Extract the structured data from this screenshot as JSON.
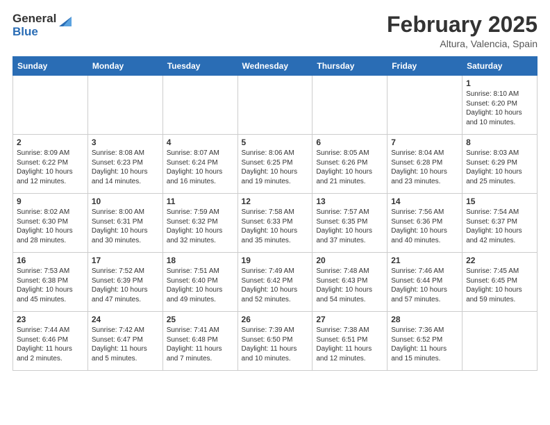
{
  "header": {
    "logo_general": "General",
    "logo_blue": "Blue",
    "month_title": "February 2025",
    "location": "Altura, Valencia, Spain"
  },
  "weekdays": [
    "Sunday",
    "Monday",
    "Tuesday",
    "Wednesday",
    "Thursday",
    "Friday",
    "Saturday"
  ],
  "weeks": [
    [
      {
        "day": "",
        "info": ""
      },
      {
        "day": "",
        "info": ""
      },
      {
        "day": "",
        "info": ""
      },
      {
        "day": "",
        "info": ""
      },
      {
        "day": "",
        "info": ""
      },
      {
        "day": "",
        "info": ""
      },
      {
        "day": "1",
        "info": "Sunrise: 8:10 AM\nSunset: 6:20 PM\nDaylight: 10 hours\nand 10 minutes."
      }
    ],
    [
      {
        "day": "2",
        "info": "Sunrise: 8:09 AM\nSunset: 6:22 PM\nDaylight: 10 hours\nand 12 minutes."
      },
      {
        "day": "3",
        "info": "Sunrise: 8:08 AM\nSunset: 6:23 PM\nDaylight: 10 hours\nand 14 minutes."
      },
      {
        "day": "4",
        "info": "Sunrise: 8:07 AM\nSunset: 6:24 PM\nDaylight: 10 hours\nand 16 minutes."
      },
      {
        "day": "5",
        "info": "Sunrise: 8:06 AM\nSunset: 6:25 PM\nDaylight: 10 hours\nand 19 minutes."
      },
      {
        "day": "6",
        "info": "Sunrise: 8:05 AM\nSunset: 6:26 PM\nDaylight: 10 hours\nand 21 minutes."
      },
      {
        "day": "7",
        "info": "Sunrise: 8:04 AM\nSunset: 6:28 PM\nDaylight: 10 hours\nand 23 minutes."
      },
      {
        "day": "8",
        "info": "Sunrise: 8:03 AM\nSunset: 6:29 PM\nDaylight: 10 hours\nand 25 minutes."
      }
    ],
    [
      {
        "day": "9",
        "info": "Sunrise: 8:02 AM\nSunset: 6:30 PM\nDaylight: 10 hours\nand 28 minutes."
      },
      {
        "day": "10",
        "info": "Sunrise: 8:00 AM\nSunset: 6:31 PM\nDaylight: 10 hours\nand 30 minutes."
      },
      {
        "day": "11",
        "info": "Sunrise: 7:59 AM\nSunset: 6:32 PM\nDaylight: 10 hours\nand 32 minutes."
      },
      {
        "day": "12",
        "info": "Sunrise: 7:58 AM\nSunset: 6:33 PM\nDaylight: 10 hours\nand 35 minutes."
      },
      {
        "day": "13",
        "info": "Sunrise: 7:57 AM\nSunset: 6:35 PM\nDaylight: 10 hours\nand 37 minutes."
      },
      {
        "day": "14",
        "info": "Sunrise: 7:56 AM\nSunset: 6:36 PM\nDaylight: 10 hours\nand 40 minutes."
      },
      {
        "day": "15",
        "info": "Sunrise: 7:54 AM\nSunset: 6:37 PM\nDaylight: 10 hours\nand 42 minutes."
      }
    ],
    [
      {
        "day": "16",
        "info": "Sunrise: 7:53 AM\nSunset: 6:38 PM\nDaylight: 10 hours\nand 45 minutes."
      },
      {
        "day": "17",
        "info": "Sunrise: 7:52 AM\nSunset: 6:39 PM\nDaylight: 10 hours\nand 47 minutes."
      },
      {
        "day": "18",
        "info": "Sunrise: 7:51 AM\nSunset: 6:40 PM\nDaylight: 10 hours\nand 49 minutes."
      },
      {
        "day": "19",
        "info": "Sunrise: 7:49 AM\nSunset: 6:42 PM\nDaylight: 10 hours\nand 52 minutes."
      },
      {
        "day": "20",
        "info": "Sunrise: 7:48 AM\nSunset: 6:43 PM\nDaylight: 10 hours\nand 54 minutes."
      },
      {
        "day": "21",
        "info": "Sunrise: 7:46 AM\nSunset: 6:44 PM\nDaylight: 10 hours\nand 57 minutes."
      },
      {
        "day": "22",
        "info": "Sunrise: 7:45 AM\nSunset: 6:45 PM\nDaylight: 10 hours\nand 59 minutes."
      }
    ],
    [
      {
        "day": "23",
        "info": "Sunrise: 7:44 AM\nSunset: 6:46 PM\nDaylight: 11 hours\nand 2 minutes."
      },
      {
        "day": "24",
        "info": "Sunrise: 7:42 AM\nSunset: 6:47 PM\nDaylight: 11 hours\nand 5 minutes."
      },
      {
        "day": "25",
        "info": "Sunrise: 7:41 AM\nSunset: 6:48 PM\nDaylight: 11 hours\nand 7 minutes."
      },
      {
        "day": "26",
        "info": "Sunrise: 7:39 AM\nSunset: 6:50 PM\nDaylight: 11 hours\nand 10 minutes."
      },
      {
        "day": "27",
        "info": "Sunrise: 7:38 AM\nSunset: 6:51 PM\nDaylight: 11 hours\nand 12 minutes."
      },
      {
        "day": "28",
        "info": "Sunrise: 7:36 AM\nSunset: 6:52 PM\nDaylight: 11 hours\nand 15 minutes."
      },
      {
        "day": "",
        "info": ""
      }
    ]
  ]
}
